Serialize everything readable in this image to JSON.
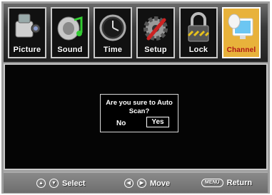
{
  "tabs": [
    {
      "label": "Picture",
      "icon": "camcorder-icon",
      "selected": false
    },
    {
      "label": "Sound",
      "icon": "speaker-music-icon",
      "selected": false
    },
    {
      "label": "Time",
      "icon": "clock-icon",
      "selected": false
    },
    {
      "label": "Setup",
      "icon": "gear-wrench-icon",
      "selected": false
    },
    {
      "label": "Lock",
      "icon": "padlock-icon",
      "selected": false
    },
    {
      "label": "Channel",
      "icon": "satellite-monitor-icon",
      "selected": true
    }
  ],
  "dialog": {
    "question": "Are you sure to Auto Scan?",
    "no_label": "No",
    "yes_label": "Yes",
    "selected": "Yes"
  },
  "hints": {
    "select": {
      "label": "Select",
      "icon": "up-down-arrows-icon"
    },
    "move": {
      "label": "Move",
      "icon": "left-right-arrows-icon"
    },
    "ret": {
      "label": "Return",
      "key": "MENU"
    }
  },
  "colors": {
    "selected_tab": "#e8b23b",
    "selected_label": "#b01515"
  }
}
